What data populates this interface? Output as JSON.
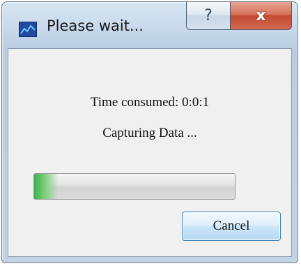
{
  "window": {
    "title": "Please wait...",
    "help_label": "?",
    "close_label": "x"
  },
  "status": {
    "time_consumed": "Time consumed: 0:0:1",
    "message": "Capturing Data ..."
  },
  "progress": {
    "value_fraction": 0.12
  },
  "buttons": {
    "cancel_label": "Cancel"
  },
  "colors": {
    "progress_fill": "#3fae4a",
    "close_button": "#c24a32",
    "button_border": "#3c7fb1"
  },
  "icons": [
    "app-icon",
    "help-icon",
    "close-icon"
  ]
}
